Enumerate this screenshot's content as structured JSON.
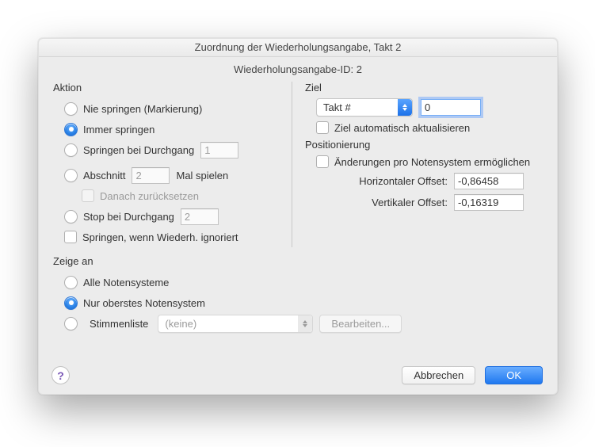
{
  "title": "Zuordnung der Wiederholungsangabe, Takt 2",
  "subtitle": "Wiederholungsangabe-ID: 2",
  "aktion": {
    "group": "Aktion",
    "nie": "Nie springen (Markierung)",
    "immer": "Immer springen",
    "springen_bei": "Springen bei Durchgang",
    "springen_bei_val": "1",
    "abschnitt": "Abschnitt",
    "abschnitt_val": "2",
    "mal_spielen": "Mal spielen",
    "danach": "Danach zurücksetzen",
    "stop_bei": "Stop bei Durchgang",
    "stop_bei_val": "2",
    "springen_ign": "Springen, wenn Wiederh. ignoriert"
  },
  "ziel": {
    "group": "Ziel",
    "select_label": "Takt #",
    "target_val": "0",
    "auto": "Ziel automatisch aktualisieren"
  },
  "pos": {
    "group": "Positionierung",
    "per_staff": "Änderungen pro Notensystem ermöglichen",
    "h_label": "Horizontaler Offset:",
    "h_val": "-0,86458",
    "v_label": "Vertikaler Offset:",
    "v_val": "-0,16319"
  },
  "zeige": {
    "group": "Zeige an",
    "alle": "Alle Notensysteme",
    "nur": "Nur oberstes Notensystem",
    "liste": "Stimmenliste",
    "liste_sel": "(keine)",
    "bearbeiten": "Bearbeiten..."
  },
  "buttons": {
    "cancel": "Abbrechen",
    "ok": "OK"
  }
}
